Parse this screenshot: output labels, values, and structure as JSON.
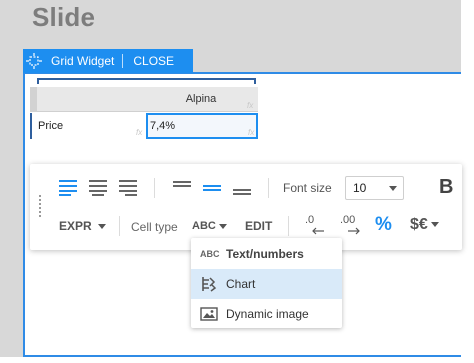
{
  "slide": {
    "title": "Slide"
  },
  "widget_bar": {
    "label": "Grid Widget",
    "close": "CLOSE"
  },
  "grid": {
    "header": {
      "col_label": "Alpina",
      "fx": "fx"
    },
    "rows": [
      {
        "label": "Price",
        "value": "7,4%",
        "fx": "fx"
      }
    ]
  },
  "toolbar": {
    "font_size_label": "Font size",
    "font_size_value": "10",
    "bold_label": "B",
    "expr_label": "EXPR",
    "cell_type_label": "Cell type",
    "cell_type_value": "ABC",
    "edit_label": "EDIT",
    "decimal_remove_label": ".0",
    "decimal_add_label": ".00",
    "percent_label": "%",
    "currency_label": "$€"
  },
  "cell_type_menu": {
    "items": [
      {
        "label": "Text/numbers",
        "icon": "abc-icon",
        "badge": "ABC"
      },
      {
        "label": "Chart",
        "icon": "chart-icon",
        "selected": true
      },
      {
        "label": "Dynamic image",
        "icon": "image-icon"
      }
    ]
  },
  "colors": {
    "accent": "#1d8ef0",
    "selected_bg": "#d9eaf9"
  }
}
